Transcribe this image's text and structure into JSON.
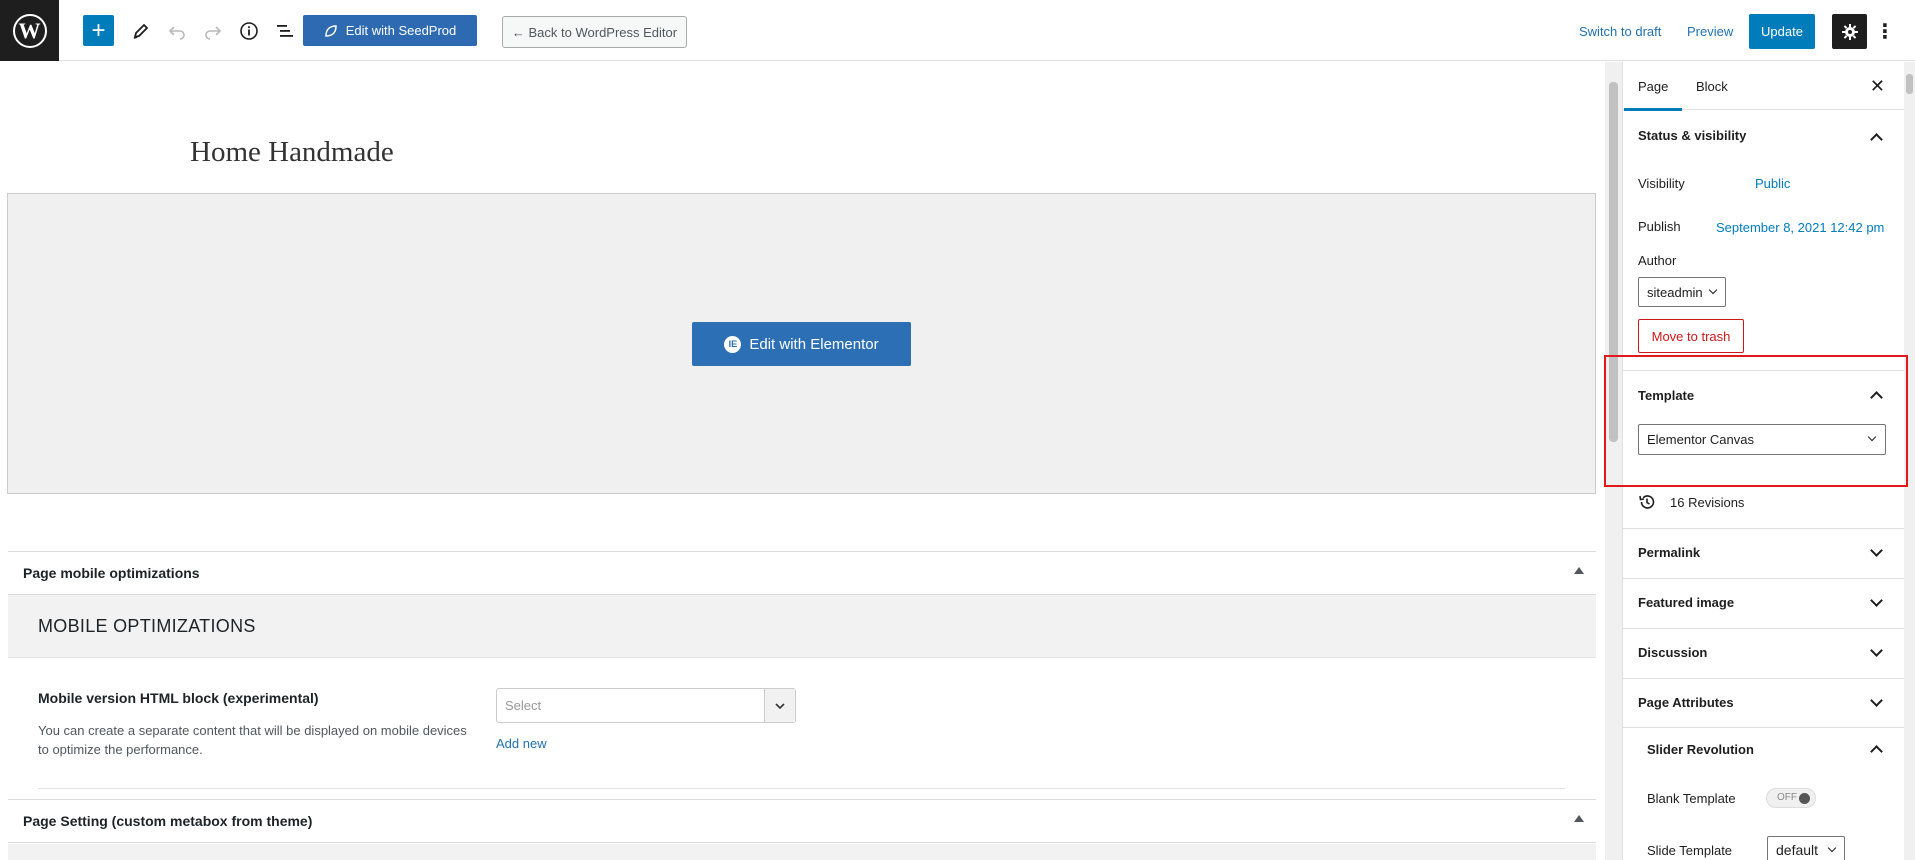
{
  "toolbar": {
    "add_label": "+",
    "seedprod_label": "Edit with SeedProd",
    "back_label": "← Back to WordPress Editor",
    "switch_draft": "Switch to draft",
    "preview": "Preview",
    "update": "Update",
    "icons": [
      "wordpress-logo-icon",
      "add-block-icon",
      "pencil-icon",
      "undo-icon",
      "redo-icon",
      "info-icon",
      "list-view-icon",
      "settings-gear-icon",
      "more-options-icon"
    ]
  },
  "editor": {
    "page_title": "Home Handmade",
    "elementor_button": "Edit with Elementor",
    "metabox_mobile_title": "Page mobile optimizations",
    "mobile_header": "MOBILE OPTIMIZATIONS",
    "mobile_field_label": "Mobile version HTML block (experimental)",
    "mobile_field_desc": "You can create a separate content that will be displayed on mobile devices to optimize the performance.",
    "mobile_select_placeholder": "Select",
    "mobile_add_new": "Add new",
    "metabox_setting_title": "Page Setting (custom metabox from theme)"
  },
  "sidebar": {
    "tabs": [
      {
        "label": "Page",
        "active": true
      },
      {
        "label": "Block",
        "active": false
      }
    ],
    "close_icon": "close-icon",
    "status_visibility": {
      "title": "Status & visibility",
      "visibility_label": "Visibility",
      "visibility_value": "Public",
      "publish_label": "Publish",
      "publish_value": "September 8, 2021 12:42 pm",
      "author_label": "Author",
      "author_value": "siteadmin",
      "trash_label": "Move to trash"
    },
    "template": {
      "title": "Template",
      "selected": "Elementor Canvas"
    },
    "revisions": "16 Revisions",
    "panels": [
      "Permalink",
      "Featured image",
      "Discussion",
      "Page Attributes"
    ],
    "slider_revolution": {
      "title": "Slider Revolution",
      "blank_template_label": "Blank Template",
      "blank_template_value": "OFF",
      "slide_template_label": "Slide Template",
      "slide_template_value": "default"
    }
  },
  "colors": {
    "accent": "#007cba",
    "highlight": "#e01a1a",
    "danger": "#cc1818",
    "elementor": "#2c6fb4",
    "seedprod": "#2e6ab1"
  }
}
